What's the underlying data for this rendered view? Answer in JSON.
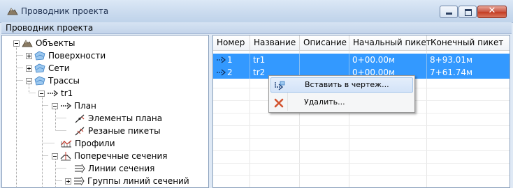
{
  "window": {
    "title": "Проводник проекта",
    "close_glyph": "✕"
  },
  "panel": {
    "header": "Проводник проекта"
  },
  "tree": {
    "nodes": [
      {
        "label": "Объекты",
        "icon": "objects-icon",
        "expander": "minus"
      },
      {
        "label": "Поверхности",
        "icon": "surface-icon",
        "expander": "plus"
      },
      {
        "label": "Сети",
        "icon": "network-icon",
        "expander": "plus"
      },
      {
        "label": "Трассы",
        "icon": "alignment-folder-icon",
        "expander": "minus"
      },
      {
        "label": "tr1",
        "icon": "alignment-icon",
        "expander": "minus"
      },
      {
        "label": "План",
        "icon": "plan-icon",
        "expander": "minus"
      },
      {
        "label": "Элементы плана",
        "icon": "plan-elements-icon",
        "expander": "none"
      },
      {
        "label": "Резаные пикеты",
        "icon": "cut-stations-icon",
        "expander": "none"
      },
      {
        "label": "Профили",
        "icon": "profiles-icon",
        "expander": "none"
      },
      {
        "label": "Поперечные сечения",
        "icon": "cross-sections-icon",
        "expander": "minus"
      },
      {
        "label": "Линии сечения",
        "icon": "section-lines-icon",
        "expander": "none"
      },
      {
        "label": "Группы линий сечений",
        "icon": "section-line-groups-icon",
        "expander": "plus"
      }
    ]
  },
  "table": {
    "columns": [
      "Номер",
      "Название",
      "Описание",
      "Начальный пикет",
      "Конечный пикет"
    ],
    "rows": [
      {
        "number": "1",
        "name": "tr1",
        "description": "",
        "start": "0+00.00м",
        "end": "8+93.01м",
        "selected": true
      },
      {
        "number": "2",
        "name": "tr2",
        "description": "",
        "start": "0+00.00м",
        "end": "7+61.74м",
        "selected": true
      }
    ]
  },
  "context_menu": {
    "items": [
      {
        "label": "Вставить в чертеж...",
        "icon": "insert-drawing-icon",
        "highlighted": true
      },
      {
        "label": "Удалить...",
        "icon": "delete-icon",
        "highlighted": false
      }
    ]
  },
  "colors": {
    "selection": "#3399ff",
    "title_bar": "#c9daee",
    "close_button": "#c43b22",
    "delete_icon": "#d2522e"
  }
}
